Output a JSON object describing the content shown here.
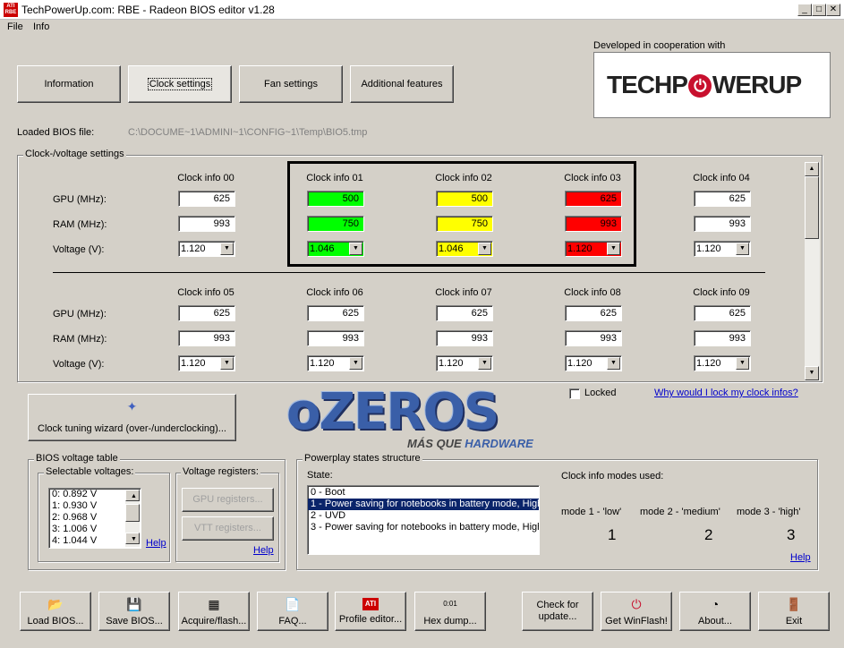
{
  "window": {
    "title": "TechPowerUp.com: RBE - Radeon BIOS editor v1.28",
    "app_icon_text": "ATI RBE",
    "controls": [
      "_",
      "□",
      "✕"
    ]
  },
  "menu": [
    "File",
    "Info"
  ],
  "tabs": [
    "Information",
    "Clock settings",
    "Fan settings",
    "Additional features"
  ],
  "partner": {
    "label": "Developed in cooperation with",
    "logo_text_left": "TECHP",
    "logo_text_right": "WERUP"
  },
  "bios_file": {
    "label": "Loaded BIOS file:",
    "path": "C:\\DOCUME~1\\ADMINI~1\\CONFIG~1\\Temp\\BIO5.tmp"
  },
  "clock": {
    "group_label": "Clock-/voltage settings",
    "row_labels": [
      "GPU (MHz):",
      "RAM (MHz):",
      "Voltage (V):"
    ],
    "top": [
      {
        "name": "Clock info 00",
        "gpu": "625",
        "ram": "993",
        "volt": "1.120",
        "color": "#ffffff"
      },
      {
        "name": "Clock info 01",
        "gpu": "500",
        "ram": "750",
        "volt": "1.046",
        "color": "#00ff00"
      },
      {
        "name": "Clock info 02",
        "gpu": "500",
        "ram": "750",
        "volt": "1.046",
        "color": "#ffff00"
      },
      {
        "name": "Clock info 03",
        "gpu": "625",
        "ram": "993",
        "volt": "1.120",
        "color": "#ff0000"
      },
      {
        "name": "Clock info 04",
        "gpu": "625",
        "ram": "993",
        "volt": "1.120",
        "color": "#ffffff"
      }
    ],
    "bottom": [
      {
        "name": "Clock info 05",
        "gpu": "625",
        "ram": "993",
        "volt": "1.120"
      },
      {
        "name": "Clock info 06",
        "gpu": "625",
        "ram": "993",
        "volt": "1.120"
      },
      {
        "name": "Clock info 07",
        "gpu": "625",
        "ram": "993",
        "volt": "1.120"
      },
      {
        "name": "Clock info 08",
        "gpu": "625",
        "ram": "993",
        "volt": "1.120"
      },
      {
        "name": "Clock info 09",
        "gpu": "625",
        "ram": "993",
        "volt": "1.120"
      }
    ]
  },
  "locked_label": "Locked",
  "lock_help": "Why would I lock my clock infos?",
  "wizard_button": "Clock tuning wizard (over-/underclocking)...",
  "watermark": {
    "main": "oZEROS",
    "sub_left": "MÁS QUE ",
    "sub_right": "HARDWARE"
  },
  "voltage_table": {
    "group_label": "BIOS voltage table",
    "selectable_label": "Selectable voltages:",
    "items": [
      "0: 0.892 V",
      "1: 0.930 V",
      "2: 0.968 V",
      "3: 1.006 V",
      "4: 1.044 V"
    ],
    "help": "Help",
    "registers_label": "Voltage registers:",
    "gpu_registers": "GPU registers...",
    "vtt_registers": "VTT registers...",
    "help2": "Help"
  },
  "powerplay": {
    "group_label": "Powerplay states structure",
    "state_label": "State:",
    "states": [
      "0 - Boot",
      "1 - Power saving for notebooks in battery mode, High p",
      "2 - UVD",
      "3 - Power saving for notebooks in battery mode, High p"
    ],
    "selected_index": 1,
    "modes_label": "Clock info modes used:",
    "modes": [
      {
        "label": "mode 1 - 'low'",
        "value": "1"
      },
      {
        "label": "mode 2 - 'medium'",
        "value": "2"
      },
      {
        "label": "mode 3 - 'high'",
        "value": "3"
      }
    ],
    "help": "Help"
  },
  "toolbar": [
    {
      "label": "Load BIOS...",
      "icon": "folder-icon",
      "glyph": "📂"
    },
    {
      "label": "Save BIOS...",
      "icon": "floppy-icon",
      "glyph": "💾"
    },
    {
      "label": "Acquire/flash...",
      "icon": "chip-icon",
      "glyph": "▦"
    },
    {
      "label": "FAQ...",
      "icon": "document-icon",
      "glyph": "📄"
    },
    {
      "label": "Profile editor...",
      "icon": "ati-logo-icon",
      "glyph": "ATI"
    },
    {
      "label": "Hex dump...",
      "icon": "hex-icon",
      "glyph": "0:01"
    },
    {
      "label": "Check for update...",
      "icon": "",
      "glyph": ""
    },
    {
      "label": "Get WinFlash!",
      "icon": "power-icon",
      "glyph": "⏻"
    },
    {
      "label": "About...",
      "icon": "clock-icon",
      "glyph": "◔"
    },
    {
      "label": "Exit",
      "icon": "exit-door-icon",
      "glyph": "🚪"
    }
  ]
}
